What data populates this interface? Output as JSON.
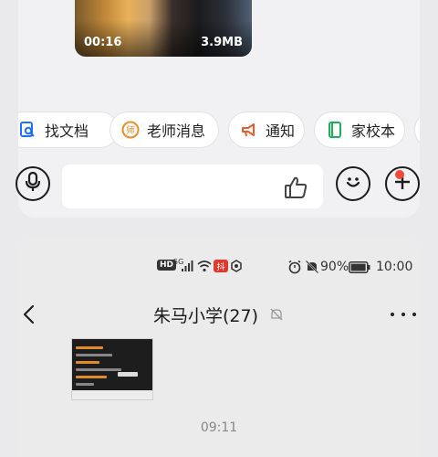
{
  "video": {
    "duration": "00:16",
    "size": "3.9MB"
  },
  "quick_chips": [
    {
      "label": "找文档",
      "icon": "find-doc-icon",
      "color": "#1e6fff"
    },
    {
      "label": "老师消息",
      "icon": "teacher-icon",
      "color": "#f08a24"
    },
    {
      "label": "通知",
      "icon": "megaphone-icon",
      "color": "#f05a28"
    },
    {
      "label": "家校本",
      "icon": "notebook-icon",
      "color": "#1fae5a"
    }
  ],
  "composer": {
    "placeholder": ""
  },
  "embedded": {
    "status": {
      "battery": "90%",
      "time": "10:00",
      "network": "5G"
    },
    "chat_title": "朱马小学(27)",
    "message_time": "09:11"
  }
}
